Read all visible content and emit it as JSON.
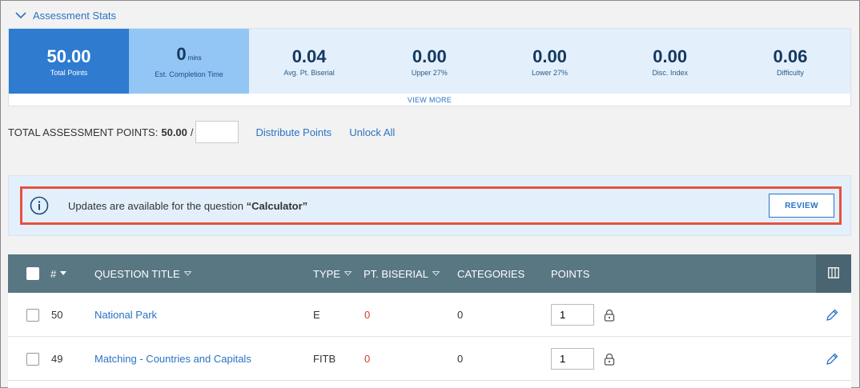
{
  "stats_header": {
    "label": "Assessment Stats"
  },
  "stats": [
    {
      "value": "50.00",
      "label": "Total Points"
    },
    {
      "value": "0",
      "unit": "mins",
      "label": "Est. Completion Time"
    },
    {
      "value": "0.04",
      "label": "Avg. Pt. Biserial"
    },
    {
      "value": "0.00",
      "label": "Upper 27%"
    },
    {
      "value": "0.00",
      "label": "Lower 27%"
    },
    {
      "value": "0.00",
      "label": "Disc. Index"
    },
    {
      "value": "0.06",
      "label": "Difficulty"
    }
  ],
  "view_more": "VIEW MORE",
  "points_bar": {
    "label": "TOTAL ASSESSMENT POINTS:",
    "total": "50.00",
    "slash": "/",
    "input_value": "",
    "distribute": "Distribute Points",
    "unlock_all": "Unlock All"
  },
  "notice": {
    "text": "Updates are available for the question",
    "question": "“Calculator”",
    "button": "REVIEW"
  },
  "table": {
    "headers": {
      "num": "#",
      "title": "QUESTION TITLE",
      "type": "TYPE",
      "biserial": "PT. BISERIAL",
      "categories": "CATEGORIES",
      "points": "POINTS"
    },
    "rows": [
      {
        "num": "50",
        "title": "National Park",
        "type": "E",
        "biserial": "0",
        "categories": "0",
        "points": "1"
      },
      {
        "num": "49",
        "title": "Matching - Countries and Capitals",
        "type": "FITB",
        "biserial": "0",
        "categories": "0",
        "points": "1"
      }
    ]
  },
  "colors": {
    "accent": "#2a73c4",
    "highlight": "#e8513f",
    "header": "#597683",
    "negative": "#d9372b"
  }
}
